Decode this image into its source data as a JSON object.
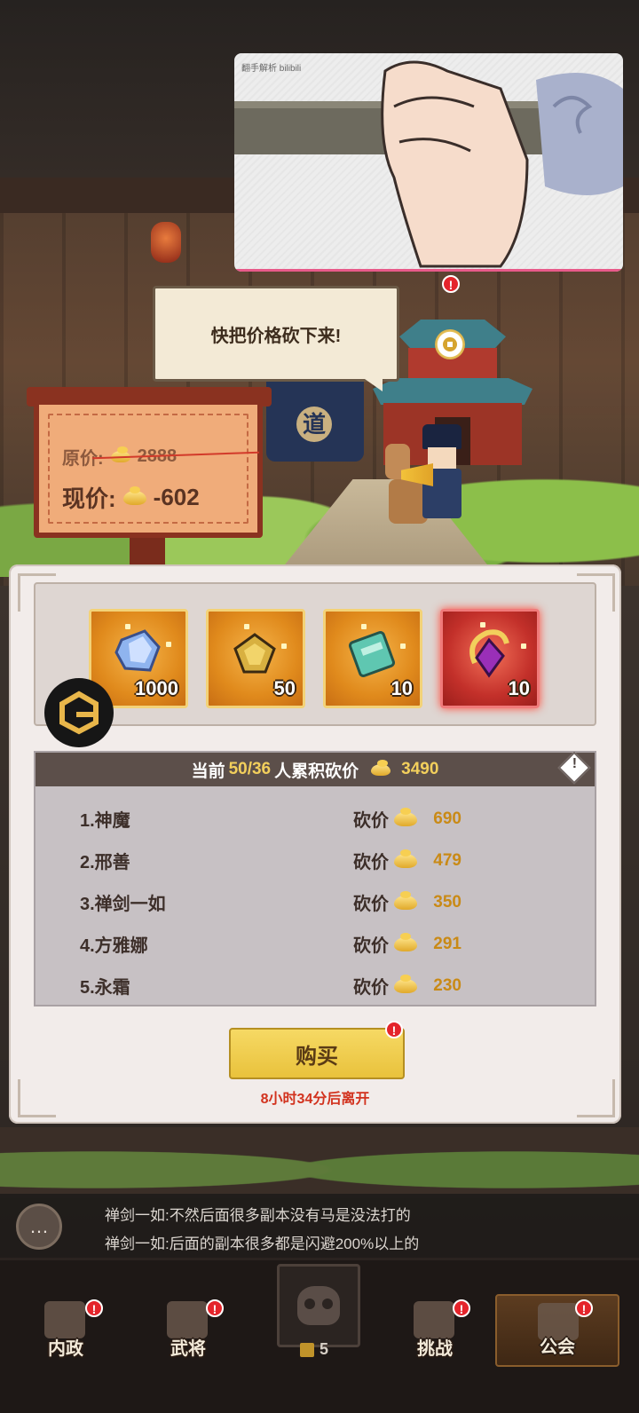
{
  "video": {
    "watermark": "翻手解析 bilibili"
  },
  "speech_bubble": {
    "text": "快把价格砍下来!"
  },
  "price_sign": {
    "original_label": "原价:",
    "original_value": "2888",
    "current_label": "现价:",
    "current_value": "-602"
  },
  "rewards": [
    {
      "name": "crystal-gem",
      "count": "1000",
      "rarity": "gold"
    },
    {
      "name": "golden-relic",
      "count": "50",
      "rarity": "gold"
    },
    {
      "name": "green-ticket",
      "count": "10",
      "rarity": "gold"
    },
    {
      "name": "purple-gem-ornament",
      "count": "10",
      "rarity": "red"
    }
  ],
  "bargain": {
    "header_prefix": "当前",
    "header_count": "50/36",
    "header_suffix": "人累积砍价",
    "header_total": "3490",
    "rows": [
      {
        "name": "1.神魔",
        "label": "砍价",
        "value": "690"
      },
      {
        "name": "2.邢善",
        "label": "砍价",
        "value": "479"
      },
      {
        "name": "3.禅剑一如",
        "label": "砍价",
        "value": "350"
      },
      {
        "name": "4.方雅娜",
        "label": "砍价",
        "value": "291"
      },
      {
        "name": "5.永霜",
        "label": "砍价",
        "value": "230"
      }
    ]
  },
  "buy_button": {
    "label": "购买"
  },
  "leave_timer": "8小时34分后离开",
  "chat": {
    "lines": [
      "禅剑一如:不然后面很多副本没有马是没法打的",
      "禅剑一如:后面的副本很多都是闪避200%以上的"
    ]
  },
  "nav": {
    "tabs": [
      {
        "label": "内政",
        "alert": "!"
      },
      {
        "label": "武将",
        "alert": "!"
      },
      {
        "label": "挑战",
        "alert": "!"
      },
      {
        "label": "公会",
        "alert": "!"
      }
    ],
    "center_count": "5"
  },
  "colors": {
    "accent_gold": "#f2cf5c",
    "alert_red": "#e4242b",
    "timer_red": "#d2321e"
  }
}
